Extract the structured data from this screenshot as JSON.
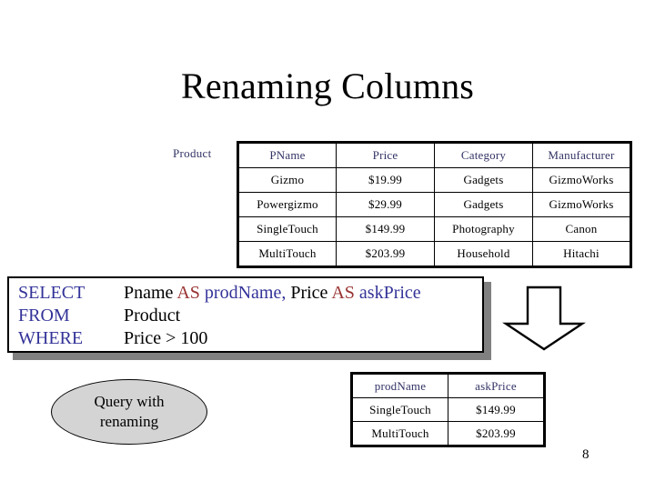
{
  "slide": {
    "title": "Renaming Columns",
    "page_number": "8"
  },
  "product_relation": {
    "label": "Product",
    "columns": [
      "PName",
      "Price",
      "Category",
      "Manufacturer"
    ],
    "rows": [
      [
        "Gizmo",
        "$19.99",
        "Gadgets",
        "GizmoWorks"
      ],
      [
        "Powergizmo",
        "$29.99",
        "Gadgets",
        "GizmoWorks"
      ],
      [
        "SingleTouch",
        "$149.99",
        "Photography",
        "Canon"
      ],
      [
        "MultiTouch",
        "$203.99",
        "Household",
        "Hitachi"
      ]
    ]
  },
  "sql": {
    "line1": {
      "keyword": "SELECT",
      "col1": "Pname",
      "as1": "AS",
      "alias1": "prodName,",
      "col2": "Price",
      "as2": "AS",
      "alias2": "askPrice"
    },
    "line2": {
      "keyword": "FROM",
      "table": "Product"
    },
    "line3": {
      "keyword": "WHERE",
      "condition": "Price > 100"
    }
  },
  "callout": {
    "line1": "Query with",
    "line2": "renaming"
  },
  "result_relation": {
    "columns": [
      "prodName",
      "askPrice"
    ],
    "rows": [
      [
        "SingleTouch",
        "$149.99"
      ],
      [
        "MultiTouch",
        "$203.99"
      ]
    ]
  },
  "icons": {
    "down_arrow": "down-arrow-icon"
  },
  "colors": {
    "keyword_blue": "#333399",
    "as_red": "#993333",
    "header_navy": "#333366",
    "ellipse_fill": "#d4d4d4",
    "shadow_gray": "#808080"
  }
}
